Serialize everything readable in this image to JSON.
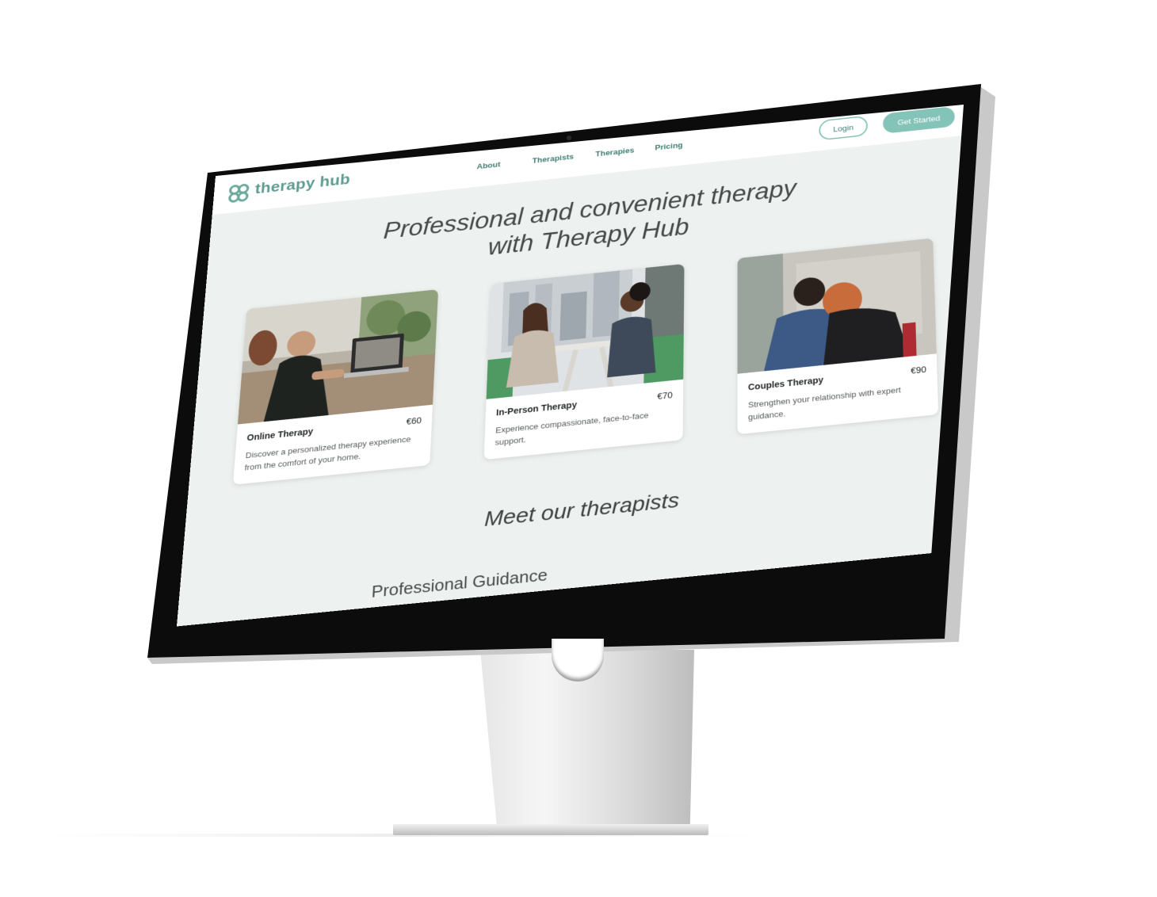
{
  "brand": {
    "name": "therapy hub",
    "logo_icon": "four-circle-logo-icon",
    "color": "#5e9c91"
  },
  "nav": {
    "items": [
      "About",
      "Therapists",
      "Therapies",
      "Pricing"
    ]
  },
  "auth": {
    "login_label": "Login",
    "cta_label": "Get Started"
  },
  "hero": {
    "title_line1": "Professional and convenient therapy",
    "title_line2": "with Therapy Hub"
  },
  "cards": [
    {
      "title": "Online Therapy",
      "price": "€60",
      "description": "Discover a personalized therapy experience from the comfort of your home.",
      "image": "man-on-video-call-photo"
    },
    {
      "title": "In-Person Therapy",
      "price": "€70",
      "description": "Experience compassionate, face-to-face support.",
      "image": "two-women-talking-at-table-photo"
    },
    {
      "title": "Couples Therapy",
      "price": "€90",
      "description": "Strengthen your relationship with expert guidance.",
      "image": "couple-leaning-together-photo"
    }
  ],
  "therapists": {
    "title": "Meet our therapists",
    "subtitle": "Professional Guidance"
  },
  "colors": {
    "accent": "#83c3b8",
    "accent_dark": "#3f7d73",
    "page_bg": "#edf1ef"
  }
}
